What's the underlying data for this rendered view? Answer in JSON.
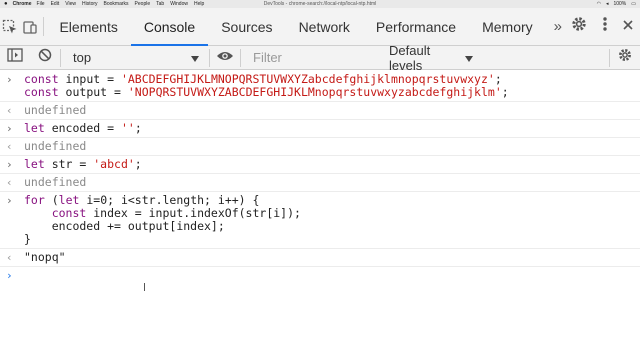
{
  "menubar": {
    "app_name": "Chrome",
    "items": [
      "File",
      "Edit",
      "View",
      "History",
      "Bookmarks",
      "People",
      "Tab",
      "Window",
      "Help"
    ],
    "window_title": "DevTools - chrome-search://local-ntp/local-ntp.html",
    "battery": "100%"
  },
  "tabs": [
    {
      "label": "Elements"
    },
    {
      "label": "Console"
    },
    {
      "label": "Sources"
    },
    {
      "label": "Network"
    },
    {
      "label": "Performance"
    },
    {
      "label": "Memory"
    }
  ],
  "more_tabs": "»",
  "toolbar": {
    "context": "top",
    "filter_placeholder": "Filter",
    "levels": "Default levels"
  },
  "console": {
    "entry1": {
      "line1": {
        "kw": "const",
        "name": " input = ",
        "str": "'ABCDEFGHIJKLMNOPQRSTUVWXYZabcdefghijklmnopqrstuvwxyz'",
        "end": ";"
      },
      "line2": {
        "kw": "const",
        "name": " output = ",
        "str": "'NOPQRSTUVWXYZABCDEFGHIJKLMnopqrstuvwxyzabcdefghijklm'",
        "end": ";"
      },
      "result": "undefined"
    },
    "entry2": {
      "kw": "let",
      "rest": " encoded = ",
      "str": "''",
      "end": ";",
      "result": "undefined"
    },
    "entry3": {
      "kw": "let",
      "rest": " str = ",
      "str": "'abcd'",
      "end": ";",
      "result": "undefined"
    },
    "entry4": {
      "line1_kw1": "for",
      "line1_a": " (",
      "line1_kw2": "let",
      "line1_b": " i=0; i<str.length; i++) {",
      "line2_kw": "    const",
      "line2_rest": " index = input.indexOf(str[i]);",
      "line3": "    encoded += output[index];",
      "line4": "}",
      "result": "\"nopq\""
    }
  },
  "glyphs": {
    "input_prompt": "›",
    "output_arrow": "‹"
  }
}
